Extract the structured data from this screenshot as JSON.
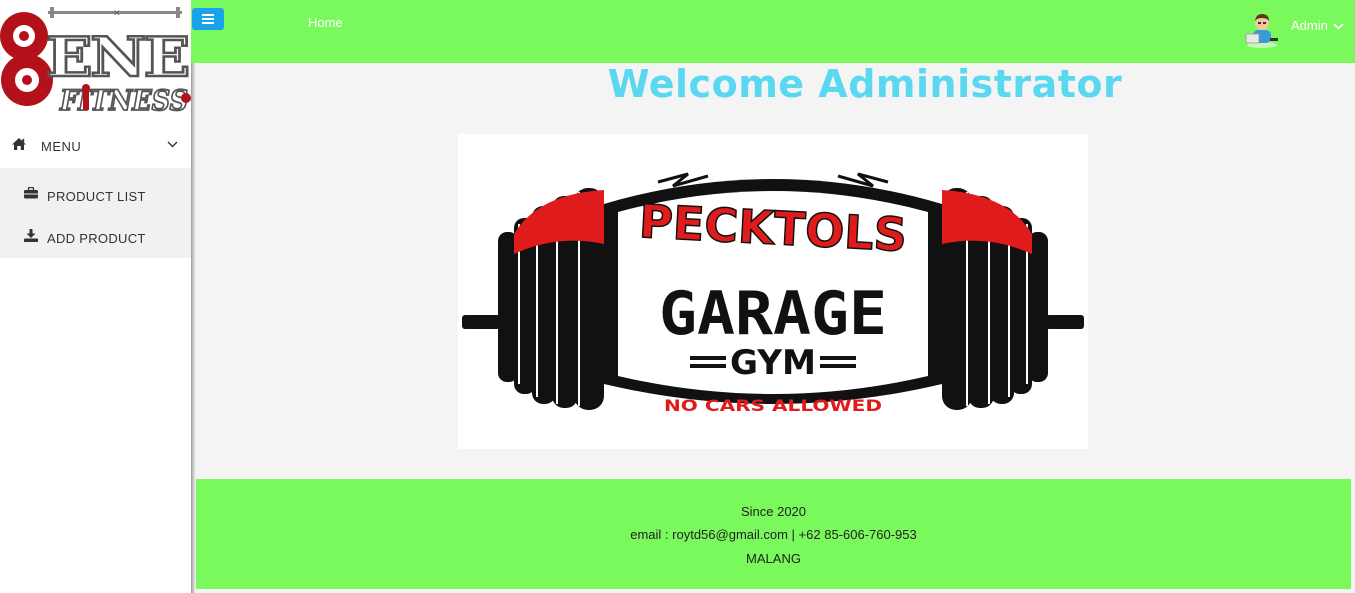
{
  "sidebar": {
    "logo_text": "BENE FITNESS",
    "menu": {
      "label": "MENU",
      "icon": "home-icon",
      "items": [
        {
          "label": "PRODUCT LIST",
          "icon": "briefcase-icon"
        },
        {
          "label": "ADD PRODUCT",
          "icon": "download-icon"
        }
      ]
    }
  },
  "topbar": {
    "breadcrumb": "Home",
    "user": {
      "name": "Admin",
      "icon": "avatar-icon"
    }
  },
  "main": {
    "title": "Welcome Administrator",
    "hero": {
      "line1": "PECKTOLS",
      "line2": "GARAGE",
      "line3": "GYM",
      "tagline": "NO CARS ALLOWED"
    }
  },
  "footer": {
    "since": "Since 2020",
    "contact": "email : roytd56@gmail.com | +62 85-606-760-953",
    "city": "MALANG"
  },
  "colors": {
    "accent_green": "#79f95b",
    "title_cyan": "#5ad8f0",
    "toggle_blue": "#1aa3e8",
    "brand_red": "#b3121b"
  }
}
